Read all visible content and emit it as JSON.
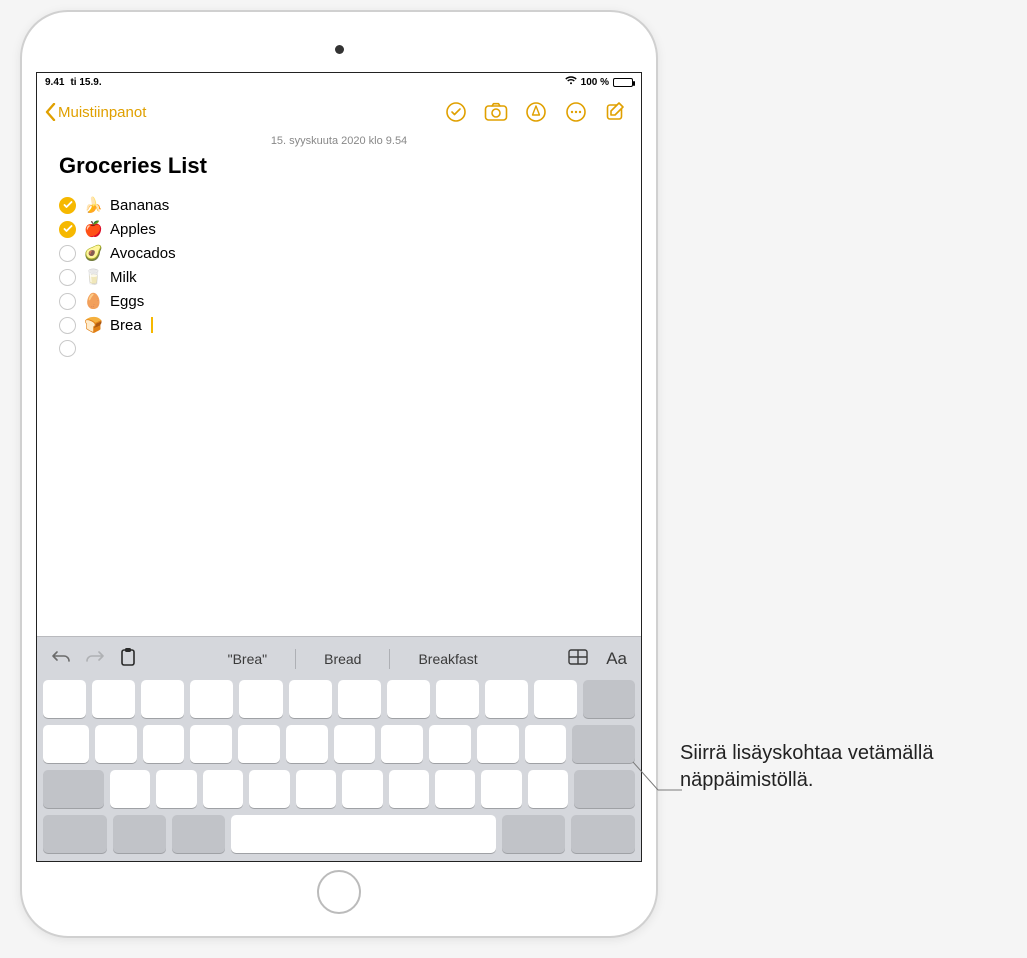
{
  "status": {
    "time": "9.41",
    "date": "ti 15.9.",
    "battery_text": "100 %"
  },
  "nav": {
    "back_label": "Muistiinpanot"
  },
  "note": {
    "date_line": "15. syyskuuta 2020 klo 9.54",
    "title": "Groceries List",
    "items": [
      {
        "checked": true,
        "emoji": "🍌",
        "text": "Bananas"
      },
      {
        "checked": true,
        "emoji": "🍎",
        "text": "Apples"
      },
      {
        "checked": false,
        "emoji": "🥑",
        "text": "Avocados"
      },
      {
        "checked": false,
        "emoji": "🥛",
        "text": "Milk"
      },
      {
        "checked": false,
        "emoji": "🥚",
        "text": "Eggs"
      },
      {
        "checked": false,
        "emoji": "🍞",
        "text": "Brea"
      },
      {
        "checked": false,
        "emoji": "",
        "text": ""
      }
    ]
  },
  "keyboard": {
    "suggestions": [
      "\"Brea\"",
      "Bread",
      "Breakfast"
    ],
    "format_label": "Aa"
  },
  "callout": {
    "text": "Siirrä lisäyskohtaa vetämällä näppäimistöllä."
  }
}
